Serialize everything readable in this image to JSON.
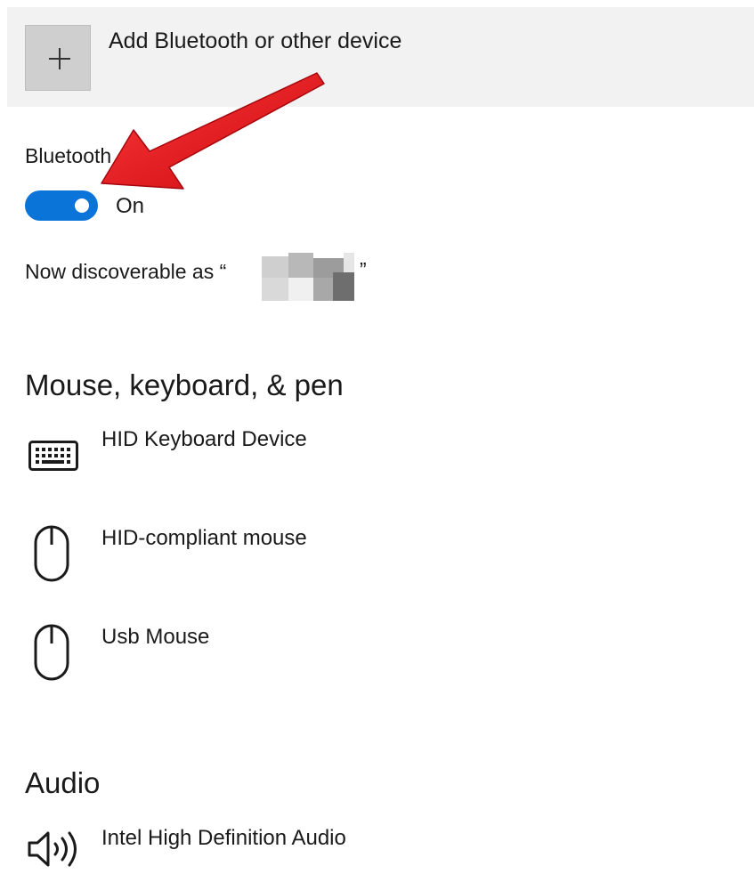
{
  "add_device": {
    "label": "Add Bluetooth or other device",
    "icon": "plus-icon"
  },
  "bluetooth": {
    "label": "Bluetooth",
    "toggle_state": "On",
    "toggle_on": true,
    "accent_color": "#0a74d8",
    "discoverable_prefix": "Now discoverable as “",
    "discoverable_suffix": "”"
  },
  "sections": {
    "mouse_keyboard_pen": {
      "title": "Mouse, keyboard, & pen",
      "devices": [
        {
          "label": "HID Keyboard Device",
          "icon": "keyboard-icon"
        },
        {
          "label": "HID-compliant mouse",
          "icon": "mouse-icon"
        },
        {
          "label": "Usb Mouse",
          "icon": "mouse-icon"
        }
      ]
    },
    "audio": {
      "title": "Audio",
      "devices": [
        {
          "label": "Intel High Definition Audio",
          "icon": "speaker-icon"
        }
      ]
    }
  },
  "annotation": {
    "type": "red-arrow",
    "color": "#e8131b",
    "points_to": "bluetooth-toggle"
  }
}
